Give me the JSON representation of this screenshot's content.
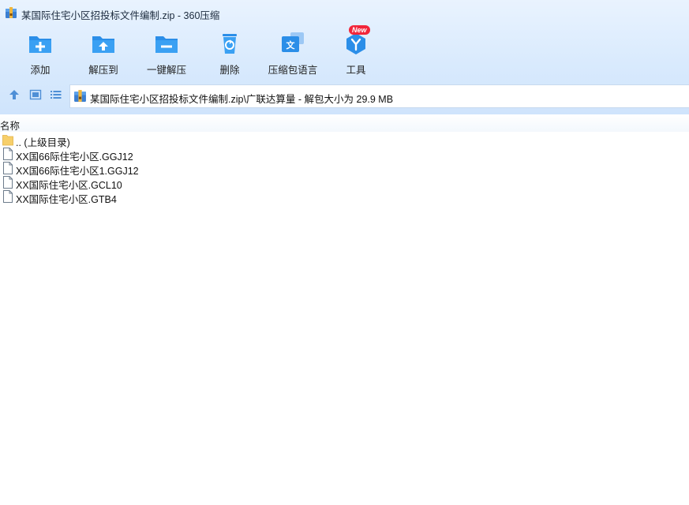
{
  "window": {
    "title": "某国际住宅小区招投标文件编制.zip - 360压缩"
  },
  "toolbar": {
    "items": [
      {
        "label": "添加",
        "icon": "add-icon"
      },
      {
        "label": "解压到",
        "icon": "extract-to-icon"
      },
      {
        "label": "一键解压",
        "icon": "one-click-extract-icon"
      },
      {
        "label": "删除",
        "icon": "delete-icon"
      },
      {
        "label": "压缩包语言",
        "icon": "archive-language-icon"
      },
      {
        "label": "工具",
        "icon": "tools-icon"
      }
    ],
    "new_badge": "New"
  },
  "navbar": {
    "path": "某国际住宅小区招投标文件编制.zip\\广联达算量 - 解包大小为 29.9 MB"
  },
  "list": {
    "column_name": "名称",
    "items": [
      {
        "name": ".. (上级目录)",
        "type": "folder"
      },
      {
        "name": "XX国66际住宅小区.GGJ12",
        "type": "file"
      },
      {
        "name": "XX国66际住宅小区1.GGJ12",
        "type": "file"
      },
      {
        "name": "XX国际住宅小区.GCL10",
        "type": "file"
      },
      {
        "name": "XX国际住宅小区.GTB4",
        "type": "file"
      }
    ]
  },
  "colors": {
    "accent": "#2b8ee8",
    "toolbar_bg": "#d9eafd",
    "badge": "#f2263a"
  }
}
